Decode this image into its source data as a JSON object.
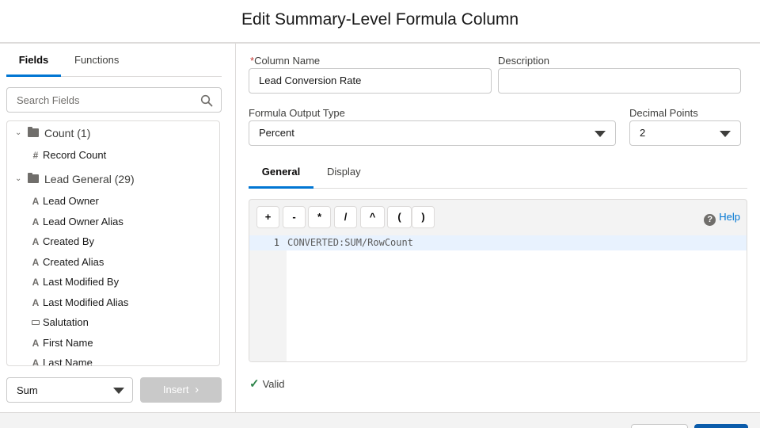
{
  "header": {
    "title": "Edit Summary-Level Formula Column"
  },
  "left_tabs": {
    "fields": "Fields",
    "functions": "Functions"
  },
  "search": {
    "placeholder": "Search Fields"
  },
  "tree": {
    "groups": [
      {
        "label": "Count (1)",
        "items": [
          {
            "label": "Record Count",
            "type": "number-icon",
            "glyph": "#"
          }
        ]
      },
      {
        "label": "Lead General (29)",
        "items": [
          {
            "label": "Lead Owner",
            "type": "text-icon",
            "glyph": "A"
          },
          {
            "label": "Lead Owner Alias",
            "type": "text-icon",
            "glyph": "A"
          },
          {
            "label": "Created By",
            "type": "text-icon",
            "glyph": "A"
          },
          {
            "label": "Created Alias",
            "type": "text-icon",
            "glyph": "A"
          },
          {
            "label": "Last Modified By",
            "type": "text-icon",
            "glyph": "A"
          },
          {
            "label": "Last Modified Alias",
            "type": "text-icon",
            "glyph": "A"
          },
          {
            "label": "Salutation",
            "type": "picklist-icon",
            "glyph": ""
          },
          {
            "label": "First Name",
            "type": "text-icon",
            "glyph": "A"
          },
          {
            "label": "Last Name",
            "type": "text-icon",
            "glyph": "A"
          }
        ]
      }
    ]
  },
  "summary_select": {
    "value": "Sum"
  },
  "insert_button": {
    "label": "Insert",
    "chevron": "›"
  },
  "form": {
    "required_mark": "*",
    "column_name_label": "Column Name",
    "column_name_value": "Lead Conversion Rate",
    "description_label": "Description",
    "description_value": "",
    "output_type_label": "Formula Output Type",
    "output_type_value": "Percent",
    "decimal_label": "Decimal Points",
    "decimal_value": "2"
  },
  "right_tabs": {
    "general": "General",
    "display": "Display"
  },
  "operators": [
    "+",
    "-",
    "*",
    "/",
    "^",
    "(",
    ")"
  ],
  "help": {
    "icon": "?",
    "label": "Help"
  },
  "editor": {
    "line_number": "1",
    "code": "CONVERTED:SUM/RowCount"
  },
  "status": {
    "check": "✓",
    "text": "Valid"
  },
  "colors": {
    "accent": "#0176d3",
    "valid": "#2e844a",
    "primary_button": "#0b5cab"
  }
}
